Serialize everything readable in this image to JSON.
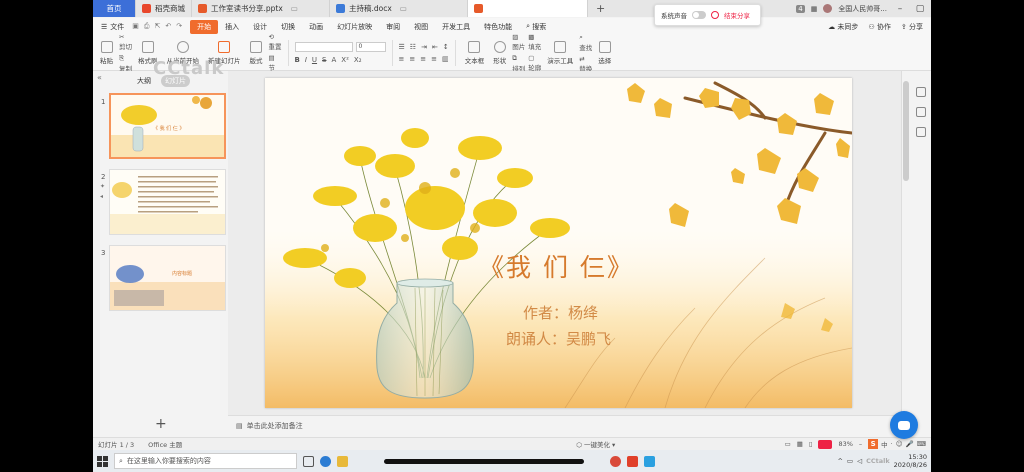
{
  "watermark": "CCtalk",
  "tabs": [
    {
      "label": "首页",
      "type": "home"
    },
    {
      "label": "稻壳商城",
      "type": "app"
    },
    {
      "label": "工作室读书分享.pptx",
      "type": "doc"
    },
    {
      "label": "主持稿.docx",
      "type": "doc"
    }
  ],
  "tabbar_right": {
    "badge": "4",
    "account": "全国人民帅哥..."
  },
  "popup": {
    "sound_label": "系统声音",
    "stop_label": "结束分享"
  },
  "menu": {
    "file": "文件",
    "items": [
      "开始",
      "插入",
      "设计",
      "切换",
      "动画",
      "幻灯片放映",
      "审阅",
      "视图",
      "开发工具",
      "特色功能"
    ],
    "active": "开始",
    "search": "搜索",
    "right": [
      "未同步",
      "协作",
      "分享"
    ]
  },
  "ribbon": {
    "paste": "粘贴",
    "cut": "剪切",
    "copy": "复制",
    "format_painter": "格式刷",
    "play_from_current": "从当前开始",
    "new_slide": "新建幻灯片",
    "layout": "版式",
    "reset": "重置",
    "section": "节",
    "font_size": "0",
    "font_format": [
      "B",
      "I",
      "U",
      "S",
      "A",
      "X²",
      "X₂"
    ],
    "textbox": "文本框",
    "shape": "形状",
    "picture": "图片",
    "arrange": "排列",
    "fill": "填充",
    "outline": "轮廓",
    "presentation_tools": "演示工具",
    "find": "查找",
    "replace": "替换",
    "select": "选择"
  },
  "panel": {
    "tabs": [
      "大纲",
      "幻灯片"
    ],
    "active_tab": "幻灯片",
    "slide_numbers": [
      "1",
      "2",
      "3"
    ],
    "thumb1_title": "《 我 们 仨 》",
    "thumb3_title": "内容标题",
    "add": "+"
  },
  "slide": {
    "title": "《我  们  仨》",
    "author": "作者：杨绛",
    "reader": "朗诵人：吴鹏飞"
  },
  "notes_placeholder": "单击此处添加备注",
  "status": {
    "slide_index": "幻灯片 1 / 3",
    "theme": "Office 主题",
    "beautify": "一键美化",
    "zoom": "83%",
    "ime": [
      "中",
      "·",
      "☺",
      "🎤",
      "⌨"
    ]
  },
  "taskbar": {
    "search_placeholder": "在这里输入你要搜索的内容",
    "time": "15:30",
    "date": "2020/8/26",
    "tray_watermark": "CCtalk"
  },
  "colors": {
    "accent": "#f06c2d",
    "home_tab": "#3c6fd8",
    "title_orange": "#d67a2c"
  }
}
